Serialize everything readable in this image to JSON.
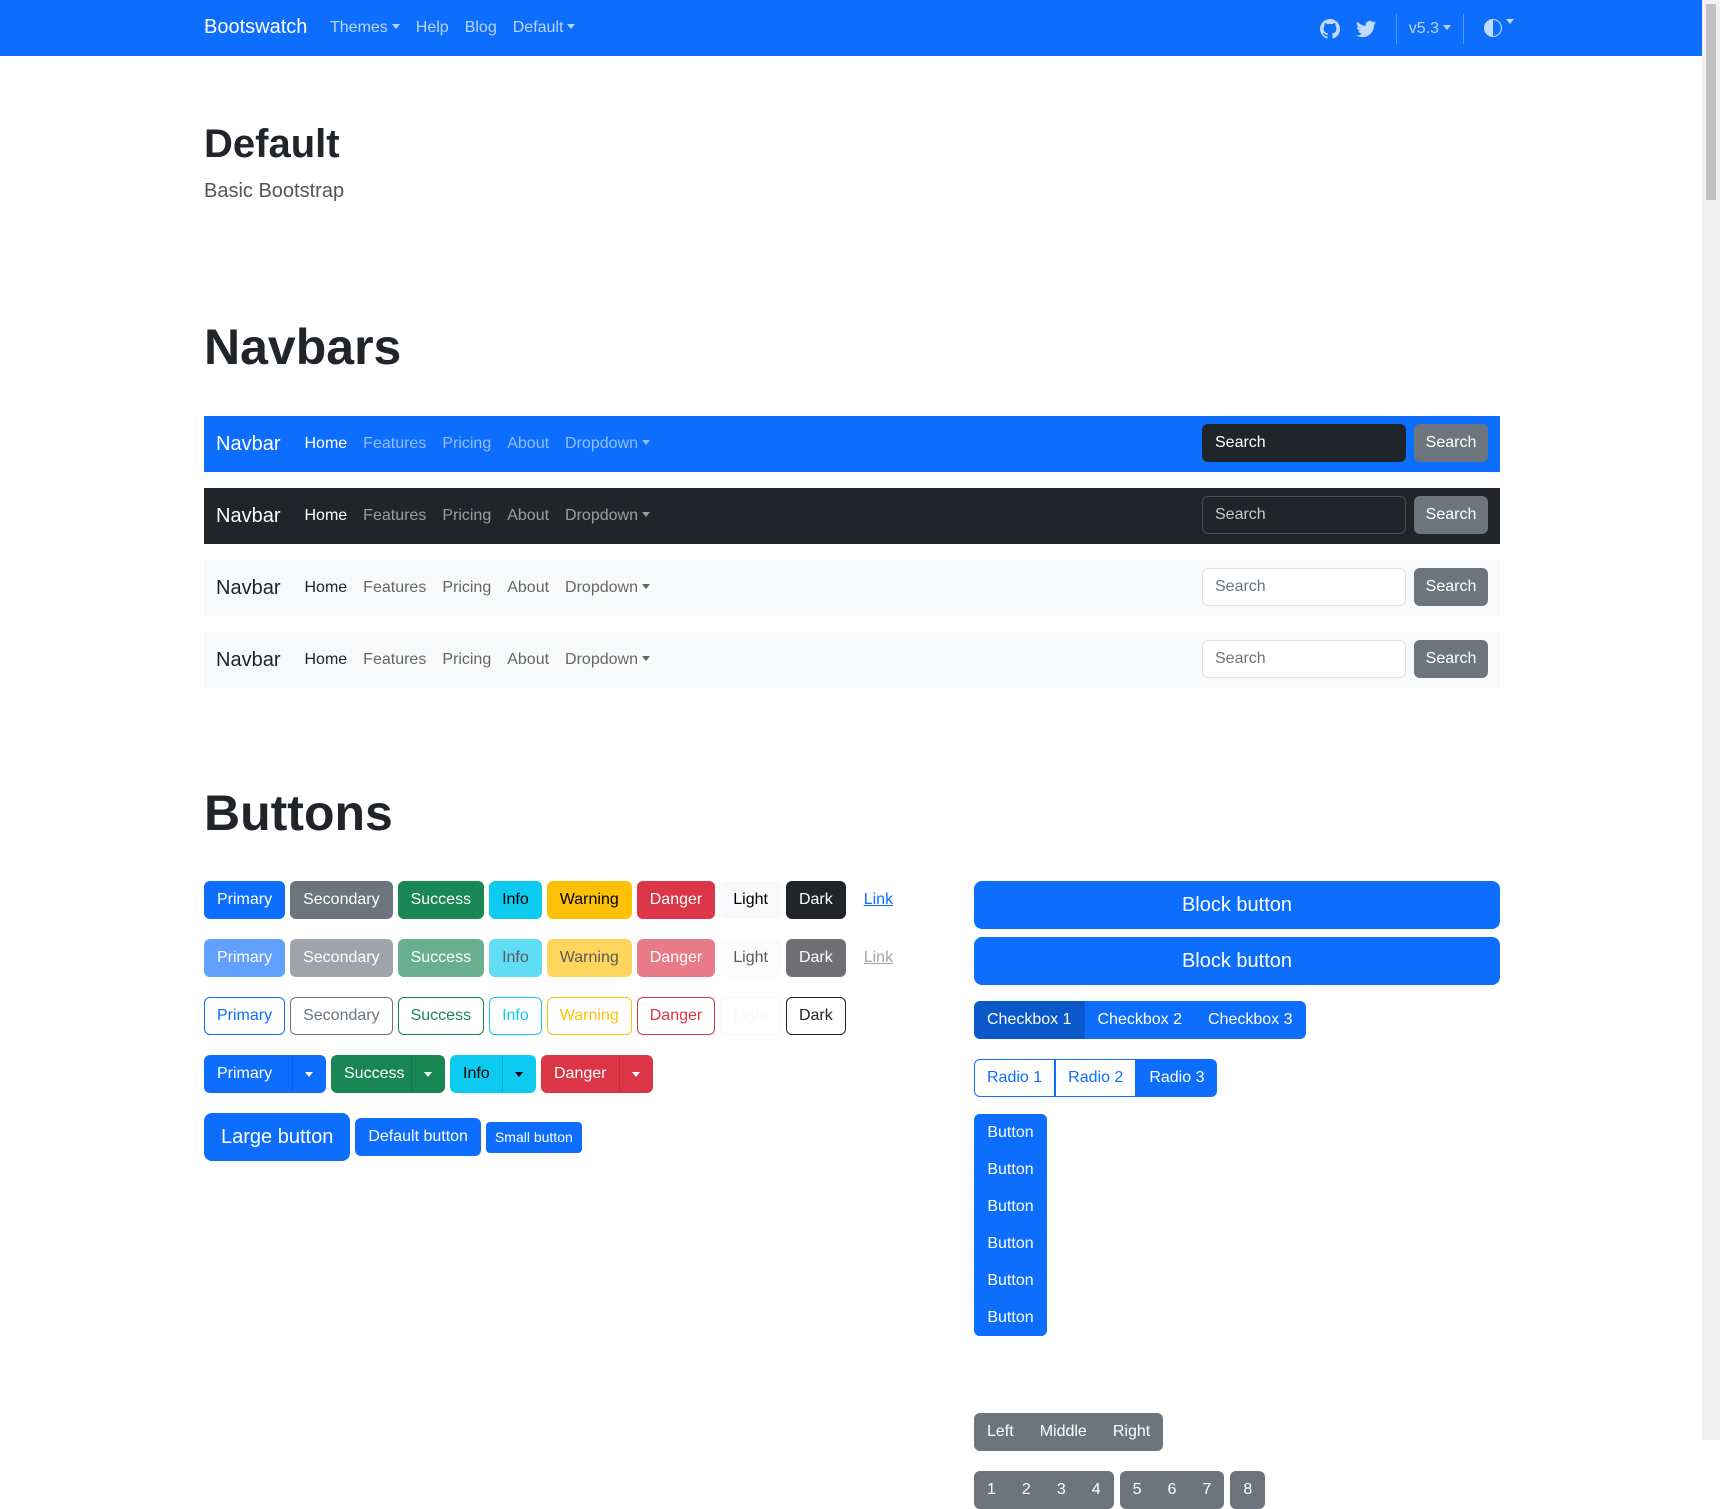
{
  "topbar": {
    "brand": "Bootswatch",
    "nav": [
      "Themes",
      "Help",
      "Blog",
      "Default"
    ],
    "version": "v5.3",
    "icons": [
      "github-icon",
      "twitter-icon",
      "theme-toggle-icon"
    ]
  },
  "header": {
    "title": "Default",
    "lead": "Basic Bootstrap"
  },
  "navbars_section": {
    "title": "Navbars",
    "brand": "Navbar",
    "links": [
      "Home",
      "Features",
      "Pricing",
      "About",
      "Dropdown"
    ],
    "search_placeholder": "Search",
    "search_button": "Search"
  },
  "buttons_section": {
    "title": "Buttons",
    "solid": [
      "Primary",
      "Secondary",
      "Success",
      "Info",
      "Warning",
      "Danger",
      "Light",
      "Dark",
      "Link"
    ],
    "disabled": [
      "Primary",
      "Secondary",
      "Success",
      "Info",
      "Warning",
      "Danger",
      "Light",
      "Dark",
      "Link"
    ],
    "outline": [
      "Primary",
      "Secondary",
      "Success",
      "Info",
      "Warning",
      "Danger",
      "Light",
      "Dark"
    ],
    "split": [
      "Primary",
      "Success",
      "Info",
      "Danger"
    ],
    "sizes": [
      "Large button",
      "Default button",
      "Small button"
    ],
    "block": [
      "Block button",
      "Block button"
    ],
    "checkboxes": [
      "Checkbox 1",
      "Checkbox 2",
      "Checkbox 3"
    ],
    "radios": [
      "Radio 1",
      "Radio 2",
      "Radio 3"
    ],
    "vertical": [
      "Button",
      "Button",
      "Button",
      "Button",
      "Button",
      "Button"
    ],
    "lmr": [
      "Left",
      "Middle",
      "Right"
    ],
    "toolbar": [
      [
        "1",
        "2",
        "3",
        "4"
      ],
      [
        "5",
        "6",
        "7"
      ],
      [
        "8"
      ]
    ]
  },
  "colors": {
    "primary": "#0d6efd",
    "secondary": "#6c757d",
    "success": "#198754",
    "info": "#0dcaf0",
    "warning": "#ffc107",
    "danger": "#dc3545",
    "dark": "#212529",
    "light": "#f8f9fa"
  }
}
